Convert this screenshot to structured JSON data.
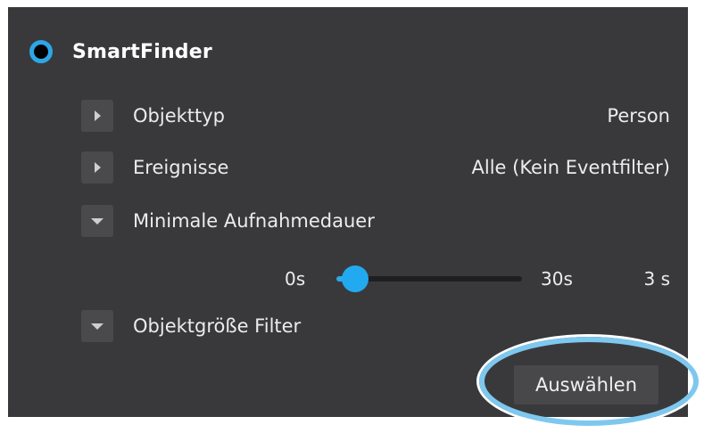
{
  "header": {
    "title": "SmartFinder",
    "selected": true
  },
  "rows": [
    {
      "label": "Objekttyp",
      "value": "Person",
      "expanded": false
    },
    {
      "label": "Ereignisse",
      "value": "Alle (Kein Eventfilter)",
      "expanded": false
    },
    {
      "label": "Minimale Aufnahmedauer",
      "expanded": true
    },
    {
      "label": "Objektgröße Filter",
      "expanded": true
    }
  ],
  "slider": {
    "min_label": "0s",
    "max_label": "30s",
    "current_label": "3 s",
    "min": 0,
    "max": 30,
    "value": 3
  },
  "action": {
    "select_label": "Auswählen"
  },
  "colors": {
    "accent": "#2da6e6",
    "panel": "#39393b",
    "highlight": "#7ec8ef"
  }
}
